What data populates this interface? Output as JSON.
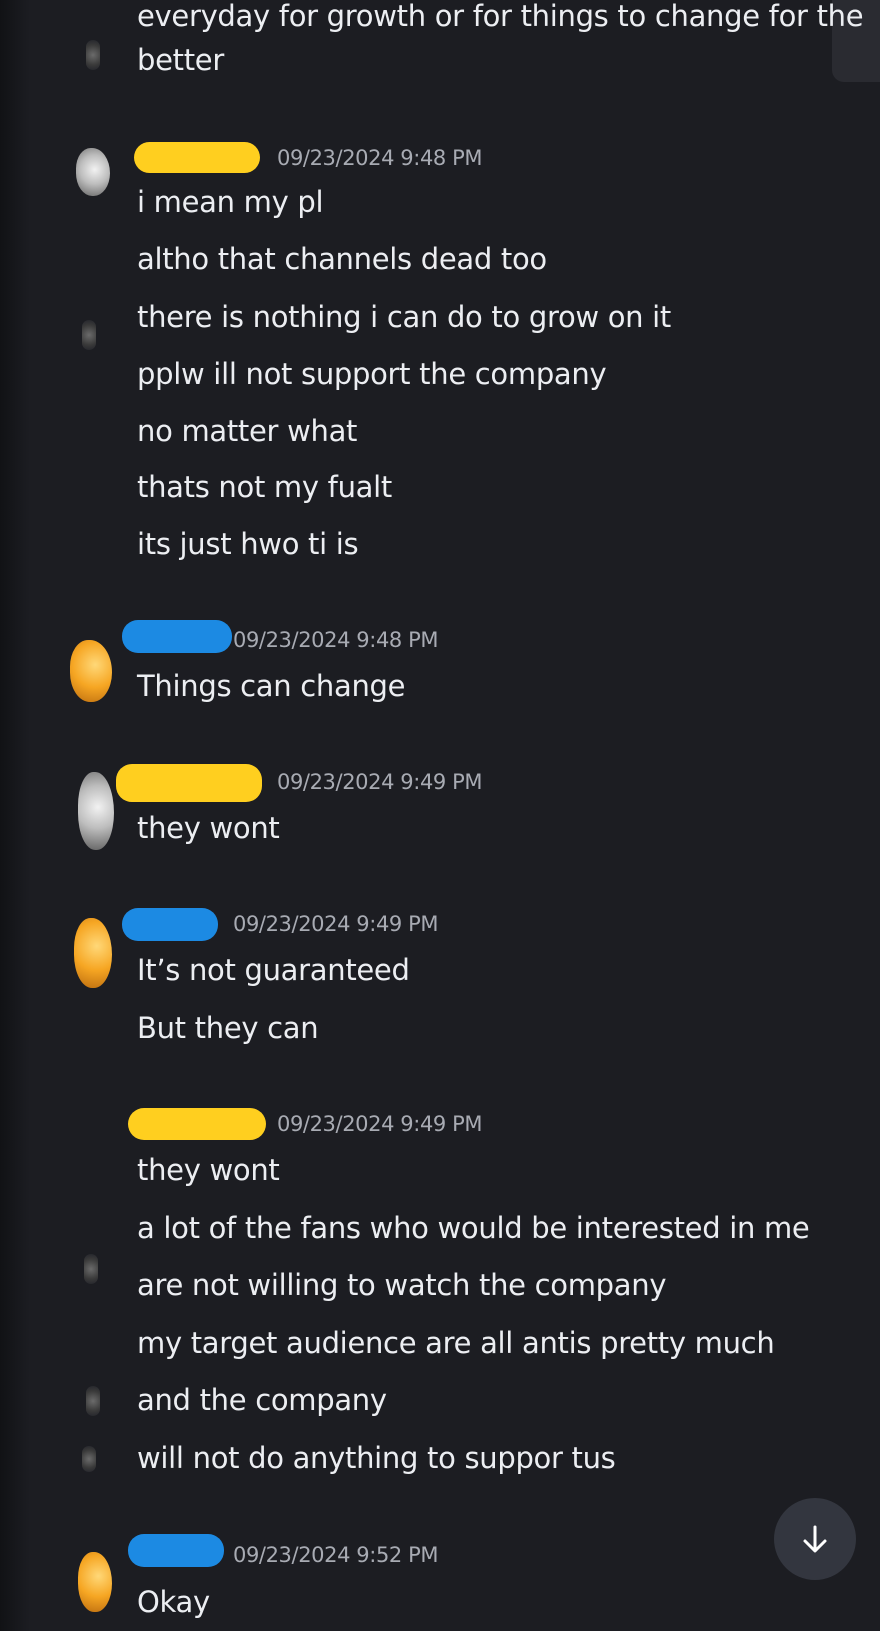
{
  "messages": [
    {
      "lines": [
        "everyday for growth or for things to change for the",
        "better"
      ]
    },
    {
      "timestamp": "09/23/2024 9:48 PM",
      "name_redaction": "yellow",
      "lines": [
        "i mean my pl",
        "altho that channels dead too",
        "there is nothing i can do to grow on it",
        "pplw ill not support the company",
        "no matter what",
        "thats not my fualt",
        "its just hwo ti is"
      ]
    },
    {
      "timestamp": "09/23/2024 9:48 PM",
      "name_redaction": "blue",
      "lines": [
        "Things can change"
      ]
    },
    {
      "timestamp": "09/23/2024 9:49 PM",
      "name_redaction": "yellow",
      "lines": [
        "they wont"
      ]
    },
    {
      "timestamp": "09/23/2024 9:49 PM",
      "name_redaction": "blue",
      "lines": [
        "It’s not guaranteed",
        "But they can"
      ]
    },
    {
      "timestamp": "09/23/2024 9:49 PM",
      "name_redaction": "yellow",
      "lines": [
        "they wont",
        "a lot of the fans who would be interested in me",
        "are not willing to watch the company",
        "my target audience are all antis pretty much",
        "and the company",
        "will not do anything to suppor tus"
      ]
    },
    {
      "timestamp": "09/23/2024 9:52 PM",
      "name_redaction": "blue",
      "lines": [
        "Okay"
      ]
    }
  ],
  "colors": {
    "background": "#1c1d22",
    "text": "#eceef2",
    "timestamp": "#a8abb3",
    "redaction_yellow": "#ffcf1f",
    "redaction_blue": "#1c8ae3"
  },
  "icons": {
    "scroll_button": "arrow-down-icon"
  }
}
